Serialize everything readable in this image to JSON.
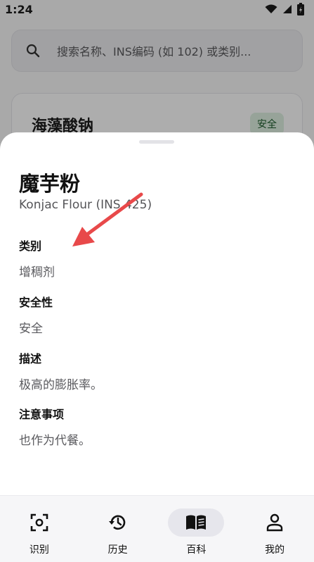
{
  "status_bar": {
    "time": "1:24"
  },
  "search": {
    "placeholder": "搜索名称、INS编码 (如 102) 或类别..."
  },
  "background_card": {
    "title": "海藻酸钠",
    "badge": "安全"
  },
  "sheet": {
    "title": "魔芋粉",
    "subtitle": "Konjac Flour (INS 425)",
    "fields": [
      {
        "label": "类别",
        "value": "增稠剂"
      },
      {
        "label": "安全性",
        "value": "安全"
      },
      {
        "label": "描述",
        "value": "极高的膨胀率。"
      },
      {
        "label": "注意事项",
        "value": "也作为代餐。"
      }
    ]
  },
  "nav": {
    "items": [
      {
        "label": "识别",
        "icon": "scan-icon"
      },
      {
        "label": "历史",
        "icon": "history-icon"
      },
      {
        "label": "百科",
        "icon": "book-icon",
        "active": true
      },
      {
        "label": "我的",
        "icon": "person-icon"
      }
    ]
  },
  "colors": {
    "arrow": "#e8494a",
    "badge_bg": "#dff1e2",
    "badge_text": "#1c5c2c"
  }
}
